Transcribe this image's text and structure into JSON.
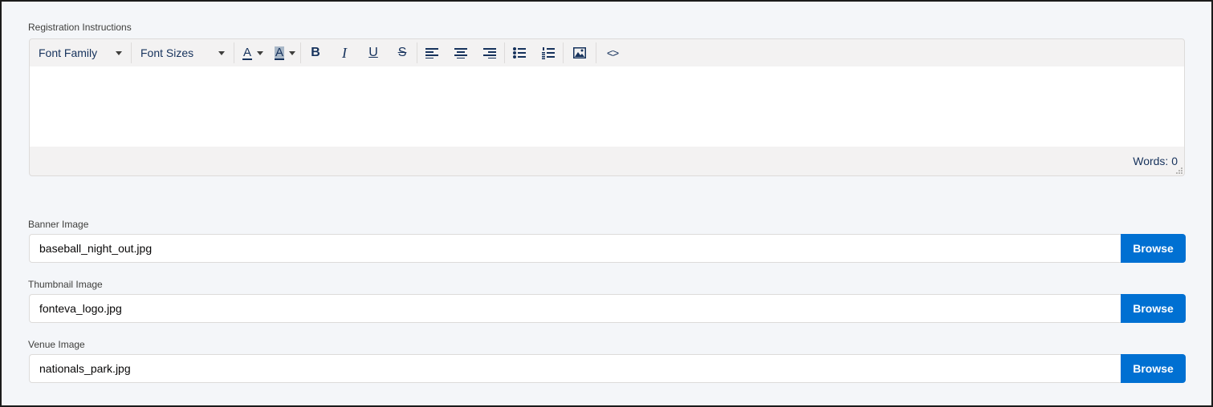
{
  "registration": {
    "label": "Registration Instructions",
    "toolbar": {
      "font_family": "Font Family",
      "font_sizes": "Font Sizes",
      "text_color_letter": "A",
      "bg_color_letter": "A",
      "bold": "B",
      "italic": "I",
      "underline": "U",
      "strike": "S",
      "source": "<>"
    },
    "word_count": "Words: 0"
  },
  "fields": [
    {
      "label": "Banner Image",
      "value": "baseball_night_out.jpg",
      "button": "Browse"
    },
    {
      "label": "Thumbnail Image",
      "value": "fonteva_logo.jpg",
      "button": "Browse"
    },
    {
      "label": "Venue Image",
      "value": "nationals_park.jpg",
      "button": "Browse"
    }
  ],
  "colors": {
    "accent": "#0070d2",
    "page_bg": "#f4f6f9",
    "text_dark": "#16325c"
  }
}
